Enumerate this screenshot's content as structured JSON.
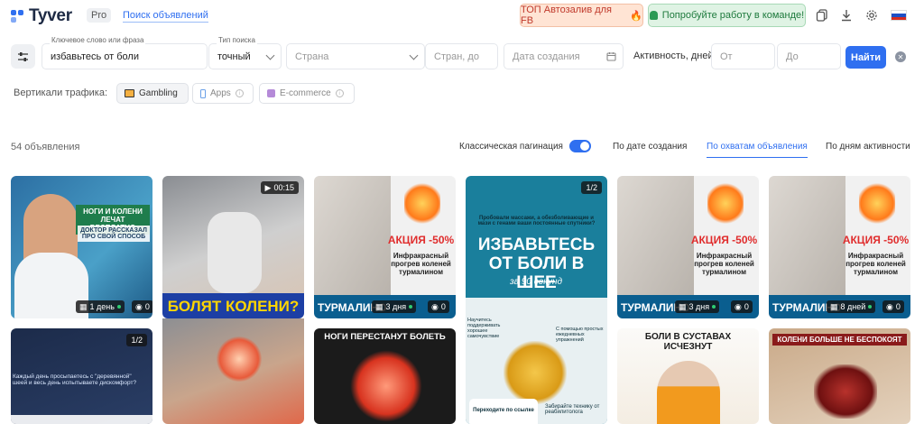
{
  "header": {
    "logo": "Tyver",
    "pro": "Pro",
    "nav_link": "Поиск объявлений",
    "promo_fb": "ТОП Автозалив для FB",
    "promo_team": "Попробуйте работу в команде!"
  },
  "search": {
    "keyword_label": "Ключевое слово или фраза",
    "keyword_value": "избавьтесь от боли",
    "type_label": "Тип поиска",
    "type_value": "точный",
    "country_placeholder": "Страна",
    "countries_placeholder": "Стран, до",
    "date_placeholder": "Дата создания",
    "activity_label": "Активность, дней",
    "from_placeholder": "От",
    "to_placeholder": "До",
    "find_button": "Найти"
  },
  "verticals": {
    "label": "Вертикали трафика:",
    "items": [
      "Gambling",
      "Apps",
      "E-commerce"
    ]
  },
  "results": {
    "count": "54 объявления",
    "pagination_label": "Классическая пагинация",
    "sort_options": [
      "По дате создания",
      "По охватам объявления",
      "По дням активности"
    ]
  },
  "cards_row1": [
    {
      "text_a": "НОГИ И КОЛЕНИ ЛЕЧАТ БЕСПЛАТНО",
      "text_b": "ДОКТОР РАССКАЗАЛ ПРО СВОЙ СПОСОБ",
      "days": "1 день",
      "views": "0"
    },
    {
      "corner": "00:15",
      "text_a": "БОЛЯТ КОЛЕНИ?"
    },
    {
      "text_a": "АКЦИЯ -50%",
      "text_b": "Инфракрасный прогрев коленей турмалином",
      "brand": "ТУРМАЛИНО",
      "days": "3 дня",
      "views": "0"
    },
    {
      "corner": "1/2",
      "text_a": "Пробовали массажи, а обезболивающие и мази с генами ваши постоянные спутники?",
      "text_b": "ИЗБАВЬТЕСЬ ОТ БОЛИ В ШЕЕ",
      "text_c": "за 90 секунд",
      "text_d": "Научитесь поддерживать хорошее самочувствие",
      "text_e": "С помощью простых ежедневных упражнений"
    },
    {
      "text_a": "АКЦИЯ -50%",
      "text_b": "Инфракрасный прогрев коленей турмалином",
      "brand": "ТУРМАЛИНО",
      "days": "3 дня",
      "views": "0"
    },
    {
      "text_a": "АКЦИЯ -50%",
      "text_b": "Инфракрасный прогрев коленей турмалином",
      "brand": "ТУРМАЛИНО",
      "days": "8 дней",
      "views": "0"
    }
  ],
  "cards_row2": [
    {
      "corner": "1/2",
      "text_a": "Каждый день просыпаетесь с \"деревянной\" шеей и весь день испытываете дискомфорт?"
    },
    {
      "text_a": "НОГИ ПЕРЕСТАНУТ БОЛЕТЬ"
    },
    {
      "text_a": "Переходите по ссылке",
      "text_b": "Забирайте технику от реабилитолога"
    },
    {
      "text_a": "БОЛИ В СУСТАВАХ ИСЧЕЗНУТ"
    },
    {
      "text_a": "КОЛЕНИ БОЛЬШЕ НЕ БЕСПОКОЯТ"
    }
  ]
}
